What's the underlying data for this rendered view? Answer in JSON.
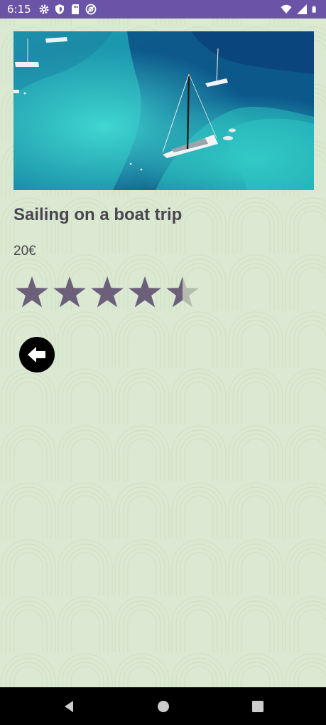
{
  "status_bar": {
    "time": "6:15",
    "left_icons": [
      "settings-icon",
      "shield-icon",
      "sd-card-icon",
      "at-sign-icon"
    ],
    "right_icons": [
      "wifi-icon",
      "cellular-signal-icon",
      "battery-icon"
    ]
  },
  "product": {
    "image_alt_icon": "sailboat-photo",
    "title": "Sailing on a boat trip",
    "price": "20€",
    "rating": 4.5,
    "rating_max": 5
  },
  "actions": {
    "back_icon": "back-arrow-icon"
  },
  "colors": {
    "status_bar": "#6a54a8",
    "background": "#dbe9d2",
    "star_filled": "#6b5f7a",
    "star_empty": "#b5bcae",
    "text": "#4a4650"
  },
  "nav_bar": {
    "buttons": [
      "back-triangle-icon",
      "home-circle-icon",
      "recents-square-icon"
    ]
  }
}
